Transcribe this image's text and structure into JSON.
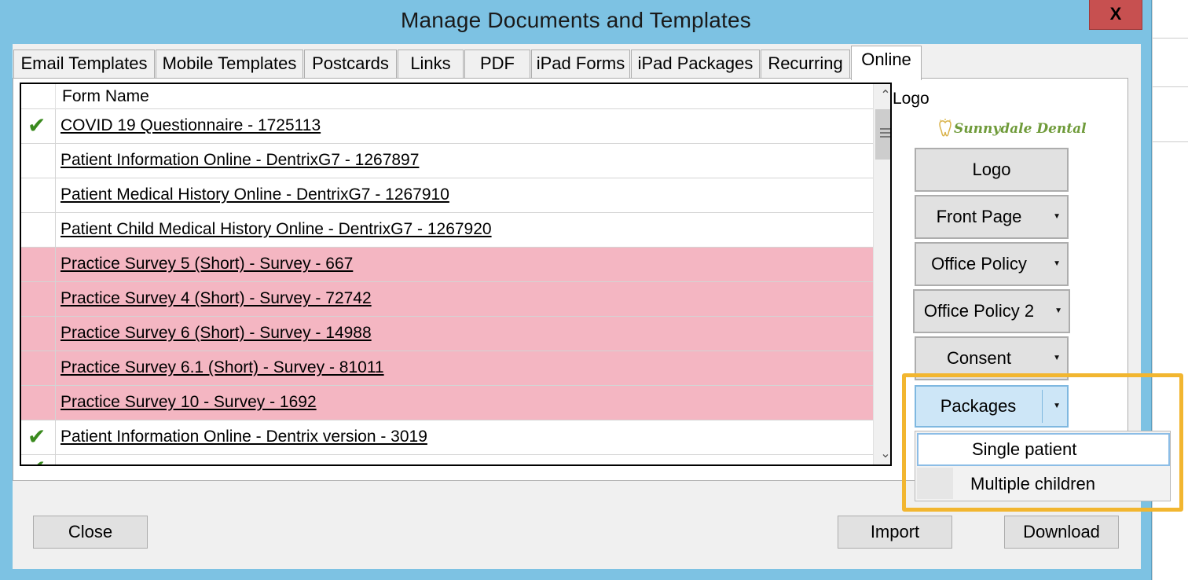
{
  "window": {
    "title": "Manage Documents and Templates",
    "close_glyph": "X"
  },
  "tabs": [
    {
      "label": "Email Templates"
    },
    {
      "label": "Mobile Templates"
    },
    {
      "label": "Postcards"
    },
    {
      "label": "Links"
    },
    {
      "label": "PDF"
    },
    {
      "label": "iPad Forms"
    },
    {
      "label": "iPad Packages"
    },
    {
      "label": "Recurring"
    },
    {
      "label": "Online",
      "active": true
    }
  ],
  "grid": {
    "column_header": "Form Name",
    "rows": [
      {
        "name": "COVID 19 Questionnaire - 1725113",
        "checked": true,
        "highlight": false
      },
      {
        "name": "Patient Information Online - DentrixG7 - 1267897",
        "checked": false,
        "highlight": false
      },
      {
        "name": "Patient Medical History Online - DentrixG7 - 1267910",
        "checked": false,
        "highlight": false
      },
      {
        "name": "Patient Child  Medical History Online - DentrixG7 - 1267920",
        "checked": false,
        "highlight": false
      },
      {
        "name": "Practice Survey 5 (Short) - Survey - 667",
        "checked": false,
        "highlight": true
      },
      {
        "name": "Practice Survey 4 (Short) - Survey - 72742",
        "checked": false,
        "highlight": true
      },
      {
        "name": "Practice Survey 6 (Short) - Survey - 14988",
        "checked": false,
        "highlight": true
      },
      {
        "name": "Practice Survey 6.1 (Short) - Survey - 81011",
        "checked": false,
        "highlight": true
      },
      {
        "name": "Practice Survey 10 - Survey - 1692",
        "checked": false,
        "highlight": true
      },
      {
        "name": "Patient Information Online - Dentrix version - 3019",
        "checked": true,
        "highlight": false
      }
    ]
  },
  "side": {
    "logo_label": "Logo",
    "logo_text": "Sunnydale Dental",
    "buttons": {
      "logo": "Logo",
      "front_page": "Front Page",
      "office_policy": "Office Policy",
      "office_policy_2": "Office Policy 2",
      "consent": "Consent",
      "packages": "Packages"
    },
    "packages_menu": [
      "Single patient",
      "Multiple children"
    ]
  },
  "footer": {
    "close": "Close",
    "import": "Import",
    "download": "Download"
  },
  "colors": {
    "title_bg": "#7dc2e3",
    "highlight_row": "#f4b6c2",
    "callout": "#f2b630",
    "check": "#3a8a1e"
  }
}
